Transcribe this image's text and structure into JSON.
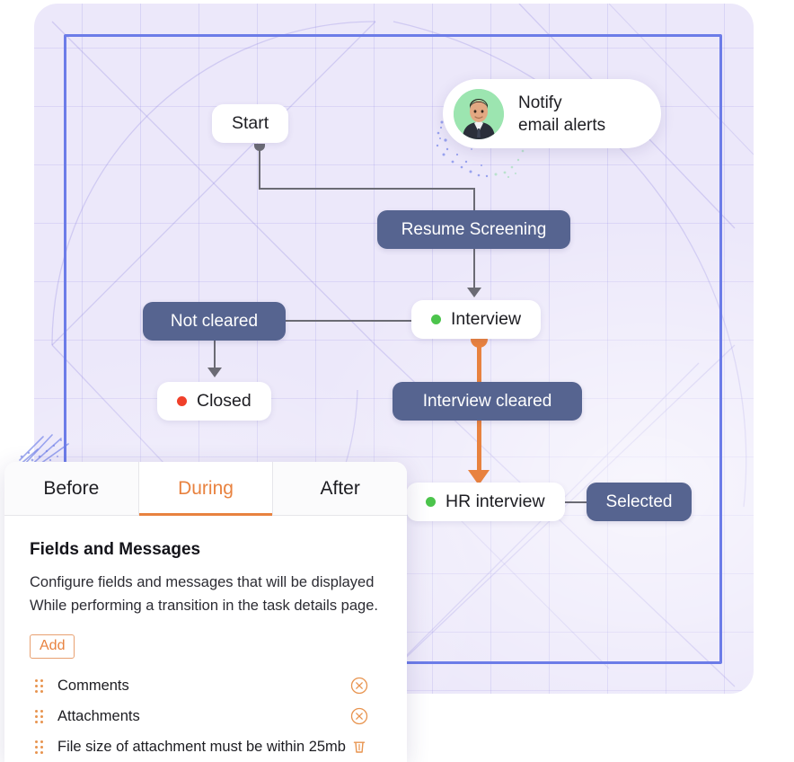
{
  "canvas": {
    "background_color": "#ece8fa",
    "grid_color": "#786edc",
    "frame_border_color": "#6c7ce8"
  },
  "diagram": {
    "nodes": [
      {
        "id": "start",
        "kind": "state",
        "label": "Start"
      },
      {
        "id": "resume",
        "kind": "action",
        "label": "Resume Screening"
      },
      {
        "id": "not_cleared",
        "kind": "action",
        "label": "Not cleared"
      },
      {
        "id": "interview",
        "kind": "state",
        "label": "Interview",
        "dot_color": "#4cc44c"
      },
      {
        "id": "closed",
        "kind": "state",
        "label": "Closed",
        "dot_color": "#f0402a"
      },
      {
        "id": "int_cleared",
        "kind": "action",
        "label": "Interview cleared"
      },
      {
        "id": "hr",
        "kind": "state",
        "label": "HR interview",
        "dot_color": "#4cc44c"
      },
      {
        "id": "selected",
        "kind": "action",
        "label": "Selected"
      }
    ],
    "colors": {
      "action_node": "#566490",
      "state_node": "#ffffff",
      "connector": "#6b6b74",
      "active_connector": "#e8823f"
    }
  },
  "notify_card": {
    "line1": "Notify",
    "line2": "email alerts",
    "avatar_name": "user-avatar"
  },
  "panel": {
    "tabs": [
      {
        "label": "Before",
        "active": false
      },
      {
        "label": "During",
        "active": true
      },
      {
        "label": "After",
        "active": false
      }
    ],
    "title": "Fields and Messages",
    "desc_line1": "Configure fields and messages that will be displayed",
    "desc_line2": "While performing a transition in the task details page.",
    "add_label": "Add",
    "fields": [
      {
        "label": "Comments",
        "action": "remove-circle-icon"
      },
      {
        "label": "Attachments",
        "action": "remove-circle-icon"
      },
      {
        "label": "File size of attachment must be within 25mb",
        "action": "trash-icon"
      }
    ],
    "accent_color": "#e8823f"
  }
}
